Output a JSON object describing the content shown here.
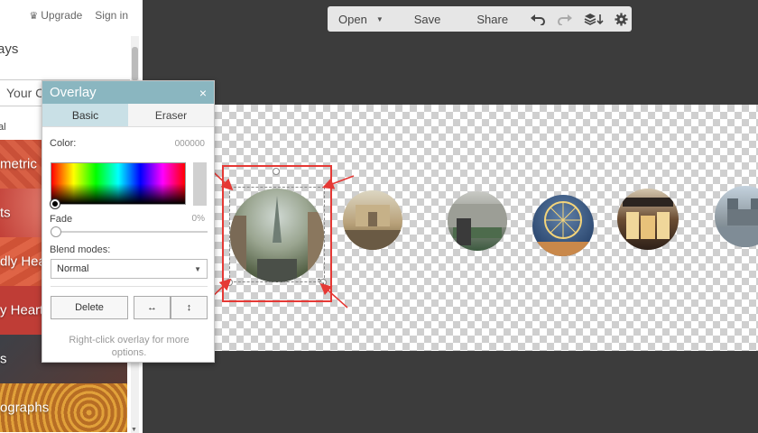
{
  "header": {
    "upgrade_label": "Upgrade",
    "signin_label": "Sign in"
  },
  "left_panel": {
    "heading": "ays",
    "search_text": "Your C",
    "section_label": "al",
    "categories": [
      {
        "label": "metric"
      },
      {
        "label": "ts"
      },
      {
        "label": "dly Hea"
      },
      {
        "label": "y Heart"
      },
      {
        "label": "s"
      },
      {
        "label": "ographs"
      }
    ]
  },
  "toolbar": {
    "open_label": "Open",
    "save_label": "Save",
    "share_label": "Share"
  },
  "overlay_dialog": {
    "title": "Overlay",
    "close_glyph": "×",
    "tabs": [
      {
        "label": "Basic",
        "active": true
      },
      {
        "label": "Eraser",
        "active": false
      }
    ],
    "color_label": "Color:",
    "color_value": "000000",
    "fade_label": "Fade",
    "fade_value": "0%",
    "fade_fraction": 0,
    "blend_label": "Blend modes:",
    "blend_value": "Normal",
    "delete_label": "Delete",
    "flip_h_glyph": "↔",
    "flip_v_glyph": "↕",
    "hint": "Right-click overlay for more options."
  },
  "canvas": {
    "photos": [
      "eiffel-street",
      "arc-carrousel",
      "louvre-courtyard",
      "ferris-wheel",
      "shop-front",
      "notre-dame"
    ],
    "highlight_color": "#e53935"
  }
}
